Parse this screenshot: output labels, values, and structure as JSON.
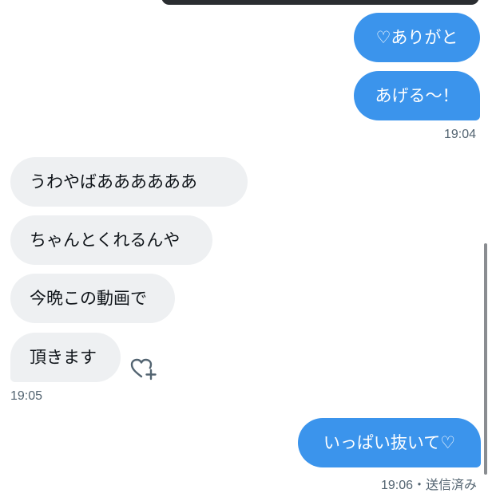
{
  "messages": [
    {
      "text": "♡ありがと"
    },
    {
      "text": "あげる〜！"
    },
    {
      "text": "うわやばああああああ"
    },
    {
      "text": "ちゃんとくれるんや"
    },
    {
      "text": "今晩この動画で"
    },
    {
      "text": "頂きます"
    },
    {
      "text": "いっぱい抜いて♡"
    }
  ],
  "timestamps": {
    "sent_group": "19:04",
    "received_group": "19:05",
    "last_sent": "19:06・送信済み"
  },
  "colors": {
    "sent_bubble": "#3b94ec",
    "received_bubble": "#eef0f2",
    "timestamp": "#536471"
  },
  "icons": {
    "reaction": "heart-plus-icon"
  }
}
